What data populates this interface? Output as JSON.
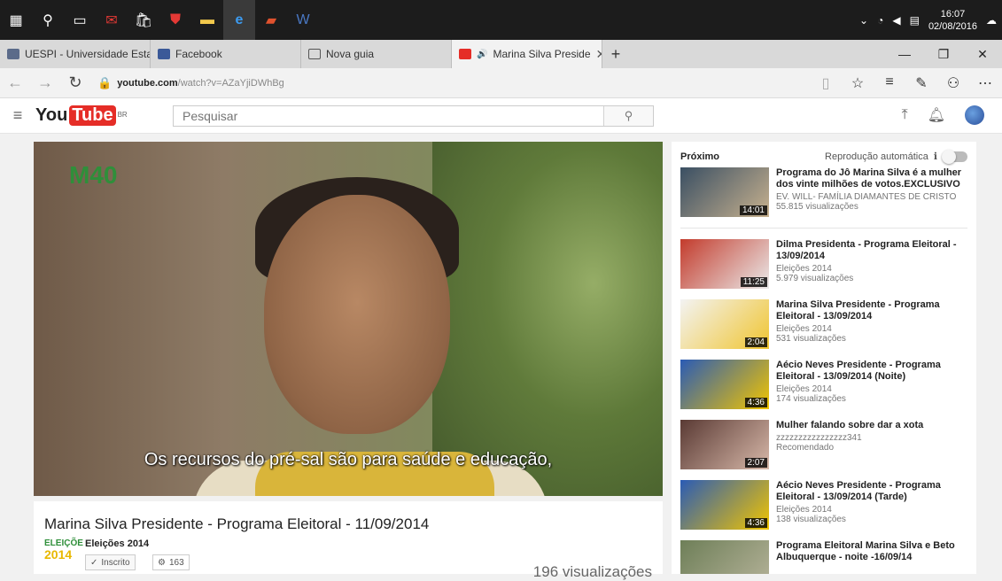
{
  "taskbar": {
    "icons": [
      "windows-start-icon",
      "search-icon",
      "task-view-icon",
      "mail-icon",
      "store-icon",
      "antivirus-icon",
      "file-explorer-icon",
      "edge-icon",
      "powerpoint-icon",
      "word-icon"
    ],
    "time": "16:07",
    "date": "02/08/2016"
  },
  "tabs": [
    {
      "label": "UESPI - Universidade Estadu",
      "icon": "uespi-icon"
    },
    {
      "label": "Facebook",
      "icon": "facebook-icon"
    },
    {
      "label": "Nova guia",
      "icon": "new-tab-icon"
    },
    {
      "label": "Marina Silva Preside",
      "icon": "youtube-icon",
      "active": true
    }
  ],
  "address": {
    "domain": "youtube.com",
    "path": "/watch?v=AZaYjiDWhBg"
  },
  "youtube": {
    "logo_you": "You",
    "logo_tube": "Tube",
    "logo_region": "BR",
    "search_placeholder": "Pesquisar"
  },
  "video": {
    "overlay_logo": "M40",
    "caption": "Os recursos do pré-sal são para saúde e educação,",
    "title": "Marina Silva Presidente - Programa Eleitoral - 11/09/2014",
    "channel_thumb_text": "ELEIÇÕE",
    "channel_thumb_year": "2014",
    "channel": "Eleições 2014",
    "subscribed_label": "Inscrito",
    "subscriber_count": "163",
    "views": "196 visualizações"
  },
  "sidebar": {
    "next_label": "Próximo",
    "autoplay_label": "Reprodução automática",
    "items": [
      {
        "title": "Programa do Jô Marina Silva é a mulher dos vinte milhões de votos.EXCLUSIVO",
        "channel": "EV. WILL- FAMÍLIA DIAMANTES DE CRISTO",
        "views": "55.815 visualizações",
        "duration": "14:01",
        "colors": [
          "#3a4f63",
          "#c7b18e"
        ]
      },
      {
        "title": "Dilma Presidenta - Programa Eleitoral - 13/09/2014",
        "channel": "Eleições 2014",
        "views": "5.979 visualizações",
        "duration": "11:25",
        "colors": [
          "#c33b2c",
          "#eaeaea"
        ]
      },
      {
        "title": "Marina Silva Presidente - Programa Eleitoral - 13/09/2014",
        "channel": "Eleições 2014",
        "views": "531 visualizações",
        "duration": "2:04",
        "colors": [
          "#f3f3f3",
          "#f0c530"
        ]
      },
      {
        "title": "Aécio Neves Presidente - Programa Eleitoral - 13/09/2014 (Noite)",
        "channel": "Eleições 2014",
        "views": "174 visualizações",
        "duration": "4:36",
        "colors": [
          "#2a5bb5",
          "#f2c500"
        ]
      },
      {
        "title": "Mulher falando sobre dar a xota",
        "channel": "zzzzzzzzzzzzzzzz341",
        "views": "Recomendado",
        "duration": "2:07",
        "colors": [
          "#5a3a34",
          "#d7b8a9"
        ]
      },
      {
        "title": "Aécio Neves Presidente - Programa Eleitoral - 13/09/2014 (Tarde)",
        "channel": "Eleições 2014",
        "views": "138 visualizações",
        "duration": "4:36",
        "colors": [
          "#2a5bb5",
          "#f2c500"
        ]
      },
      {
        "title": "Programa Eleitoral Marina Silva e Beto Albuquerque - noite -16/09/14",
        "channel": "",
        "views": "",
        "duration": "",
        "colors": [
          "#6e7f58",
          "#b6b39a"
        ]
      }
    ]
  }
}
